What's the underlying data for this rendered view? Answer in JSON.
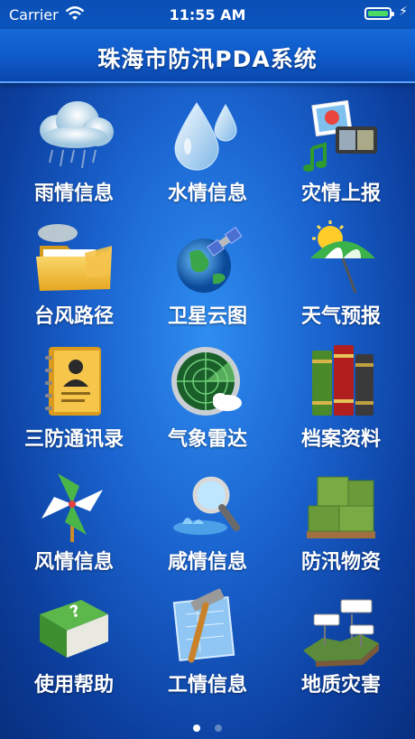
{
  "status_bar": {
    "carrier": "Carrier",
    "time": "11:55 AM",
    "battery_level": 1.0
  },
  "header": {
    "title": "珠海市防汛PDA系统"
  },
  "grid": {
    "items": [
      {
        "label": "雨情信息",
        "icon": "rain-cloud-icon"
      },
      {
        "label": "水情信息",
        "icon": "water-drops-icon"
      },
      {
        "label": "灾情上报",
        "icon": "media-photos-icon"
      },
      {
        "label": "台风路径",
        "icon": "folder-icon"
      },
      {
        "label": "卫星云图",
        "icon": "satellite-globe-icon"
      },
      {
        "label": "天气预报",
        "icon": "sun-umbrella-icon"
      },
      {
        "label": "三防通讯录",
        "icon": "address-book-icon"
      },
      {
        "label": "气象雷达",
        "icon": "radar-icon"
      },
      {
        "label": "档案资料",
        "icon": "books-icon"
      },
      {
        "label": "风情信息",
        "icon": "pinwheel-icon"
      },
      {
        "label": "咸情信息",
        "icon": "magnifier-water-icon"
      },
      {
        "label": "防汛物资",
        "icon": "supply-boxes-icon"
      },
      {
        "label": "使用帮助",
        "icon": "help-book-icon"
      },
      {
        "label": "工情信息",
        "icon": "blueprint-hammer-icon"
      },
      {
        "label": "地质灾害",
        "icon": "geology-levels-icon"
      }
    ]
  },
  "pager": {
    "current": 1,
    "total": 2
  },
  "colors": {
    "background": "#1a63cf",
    "header": "#0f5bcc",
    "battery": "#4cd964"
  }
}
